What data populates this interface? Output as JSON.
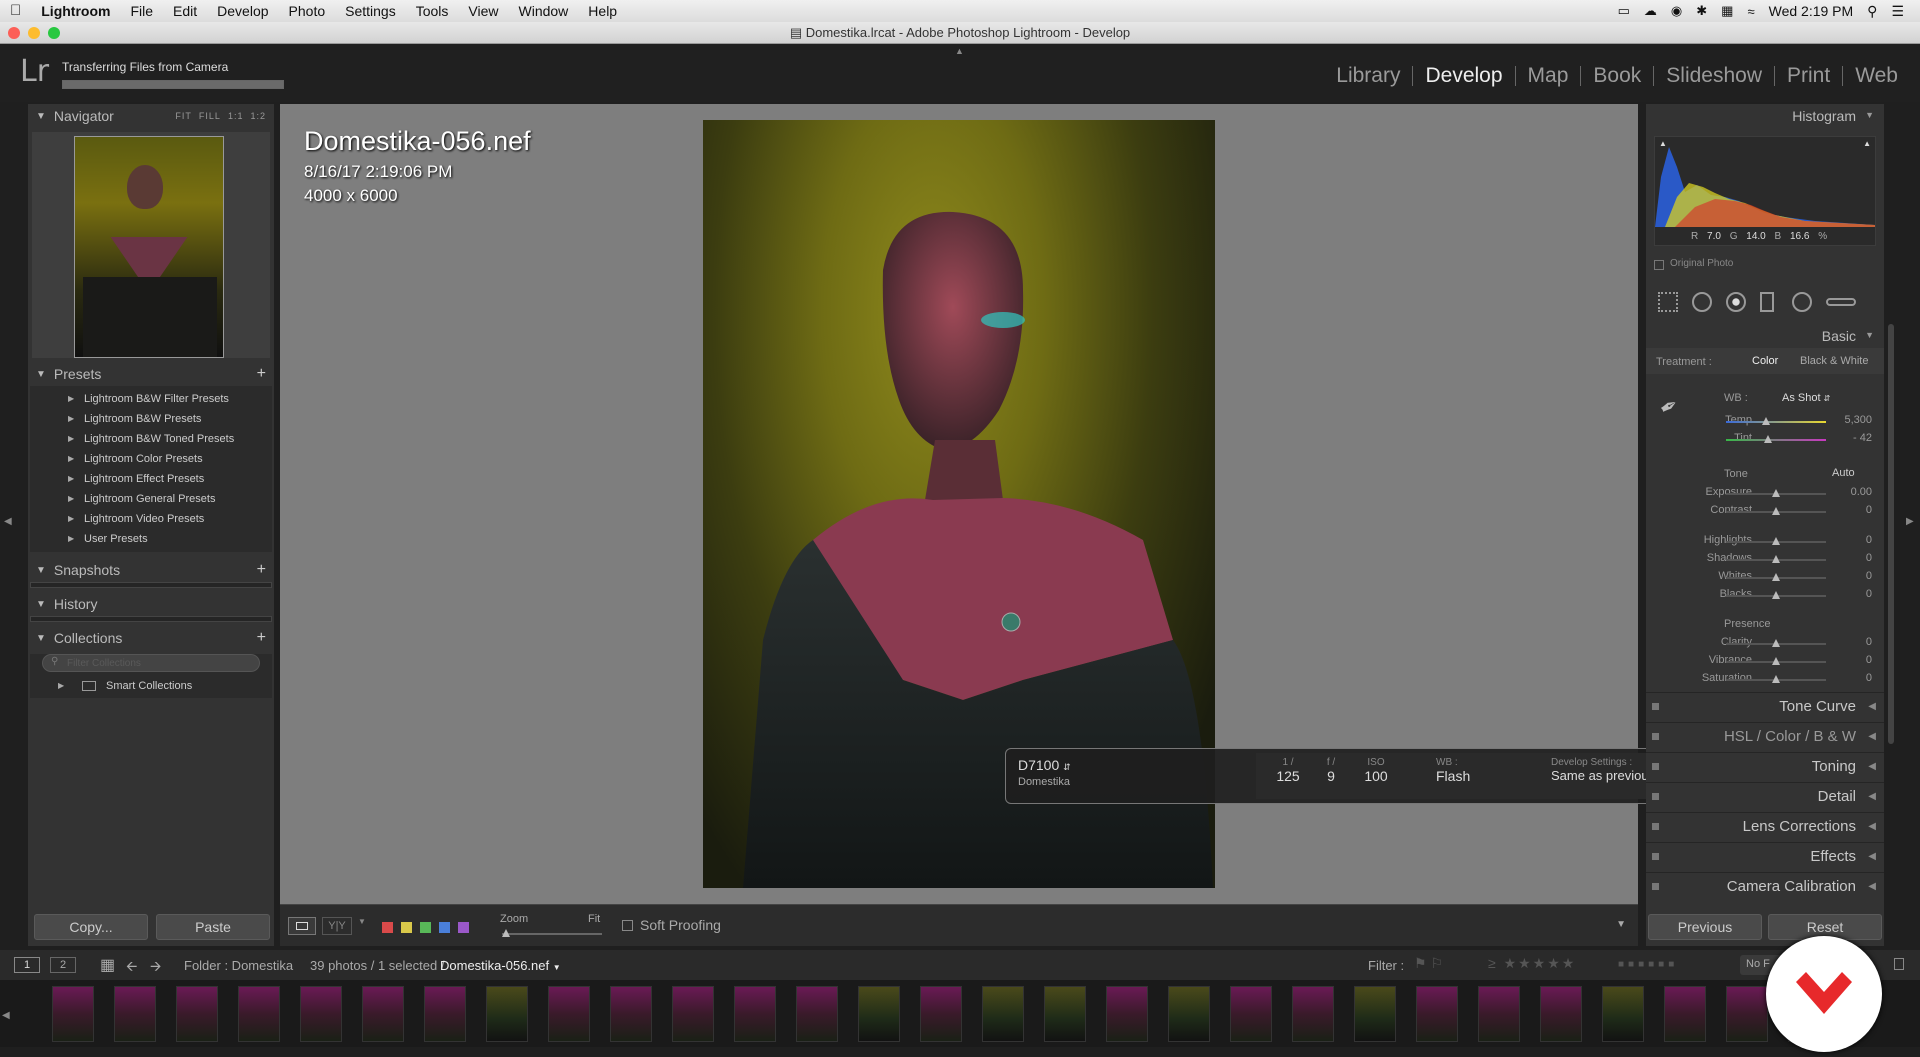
{
  "menubar": {
    "app": "Lightroom",
    "items": [
      "File",
      "Edit",
      "Develop",
      "Photo",
      "Settings",
      "Tools",
      "View",
      "Window",
      "Help"
    ],
    "clock": "Wed 2:19 PM"
  },
  "window": {
    "title": "Domestika.lrcat - Adobe Photoshop Lightroom - Develop"
  },
  "identity": {
    "logo": "Lr",
    "status": "Transferring Files from Camera",
    "progress": 1.0
  },
  "modules": [
    "Library",
    "Develop",
    "Map",
    "Book",
    "Slideshow",
    "Print",
    "Web"
  ],
  "active_module": "Develop",
  "navigator": {
    "title": "Navigator",
    "options": [
      "FIT",
      "FILL",
      "1:1",
      "1:2"
    ]
  },
  "presets": {
    "title": "Presets",
    "items": [
      "Lightroom B&W Filter Presets",
      "Lightroom B&W Presets",
      "Lightroom B&W Toned Presets",
      "Lightroom Color Presets",
      "Lightroom Effect Presets",
      "Lightroom General Presets",
      "Lightroom Video Presets",
      "User Presets"
    ]
  },
  "snapshots": {
    "title": "Snapshots"
  },
  "history": {
    "title": "History"
  },
  "collections": {
    "title": "Collections",
    "search_placeholder": "Filter Collections",
    "smart": "Smart Collections"
  },
  "left_buttons": {
    "copy": "Copy...",
    "paste": "Paste"
  },
  "photo_info": {
    "filename": "Domestika-056.nef",
    "datetime": "8/16/17 2:19:06 PM",
    "dimensions": "4000 x 6000"
  },
  "hud": {
    "camera": "D7100",
    "owner": "Domestika",
    "shutter_label": "1 /",
    "shutter": "125",
    "aperture_label": "f /",
    "aperture": "9",
    "iso_label": "ISO",
    "iso": "100",
    "wb_label": "WB :",
    "wb": "Flash",
    "dev_label": "Develop Settings :",
    "dev": "Same as previous"
  },
  "toolbar": {
    "zoom_label": "Zoom",
    "fit_label": "Fit",
    "soft_proofing": "Soft Proofing",
    "swatches": [
      "#d94a4a",
      "#d9c84a",
      "#58b858",
      "#4a7fd9",
      "#9a58c8"
    ]
  },
  "histogram": {
    "title": "Histogram",
    "readout": [
      "R",
      "7.0",
      "G",
      "14.0",
      "B",
      "16.6",
      "%"
    ],
    "original_photo": "Original Photo"
  },
  "basic": {
    "title": "Basic",
    "treatment_label": "Treatment :",
    "treatment_color": "Color",
    "treatment_bw": "Black & White",
    "wb_label": "WB :",
    "wb_value": "As Shot",
    "temp": {
      "label": "Temp",
      "value": "5,300"
    },
    "tint": {
      "label": "Tint",
      "value": "- 42"
    },
    "tone_label": "Tone",
    "auto": "Auto",
    "exposure": {
      "label": "Exposure",
      "value": "0.00"
    },
    "contrast": {
      "label": "Contrast",
      "value": "0"
    },
    "highlights": {
      "label": "Highlights",
      "value": "0"
    },
    "shadows": {
      "label": "Shadows",
      "value": "0"
    },
    "whites": {
      "label": "Whites",
      "value": "0"
    },
    "blacks": {
      "label": "Blacks",
      "value": "0"
    },
    "presence_label": "Presence",
    "clarity": {
      "label": "Clarity",
      "value": "0"
    },
    "vibrance": {
      "label": "Vibrance",
      "value": "0"
    },
    "saturation": {
      "label": "Saturation",
      "value": "0"
    }
  },
  "right_sections": {
    "tone_curve": "Tone Curve",
    "hsl": "HSL",
    "color": "Color",
    "bw": "B & W",
    "toning": "Toning",
    "detail": "Detail",
    "lens": "Lens Corrections",
    "effects": "Effects",
    "calibration": "Camera Calibration"
  },
  "right_buttons": {
    "previous": "Previous",
    "reset": "Reset"
  },
  "filmbar": {
    "page1": "1",
    "page2": "2",
    "folder": "Folder : Domestika",
    "count": "39 photos / 1 selected /",
    "selected": "Domestika-056.nef",
    "filter_label": "Filter :",
    "no_filter": "No F"
  }
}
